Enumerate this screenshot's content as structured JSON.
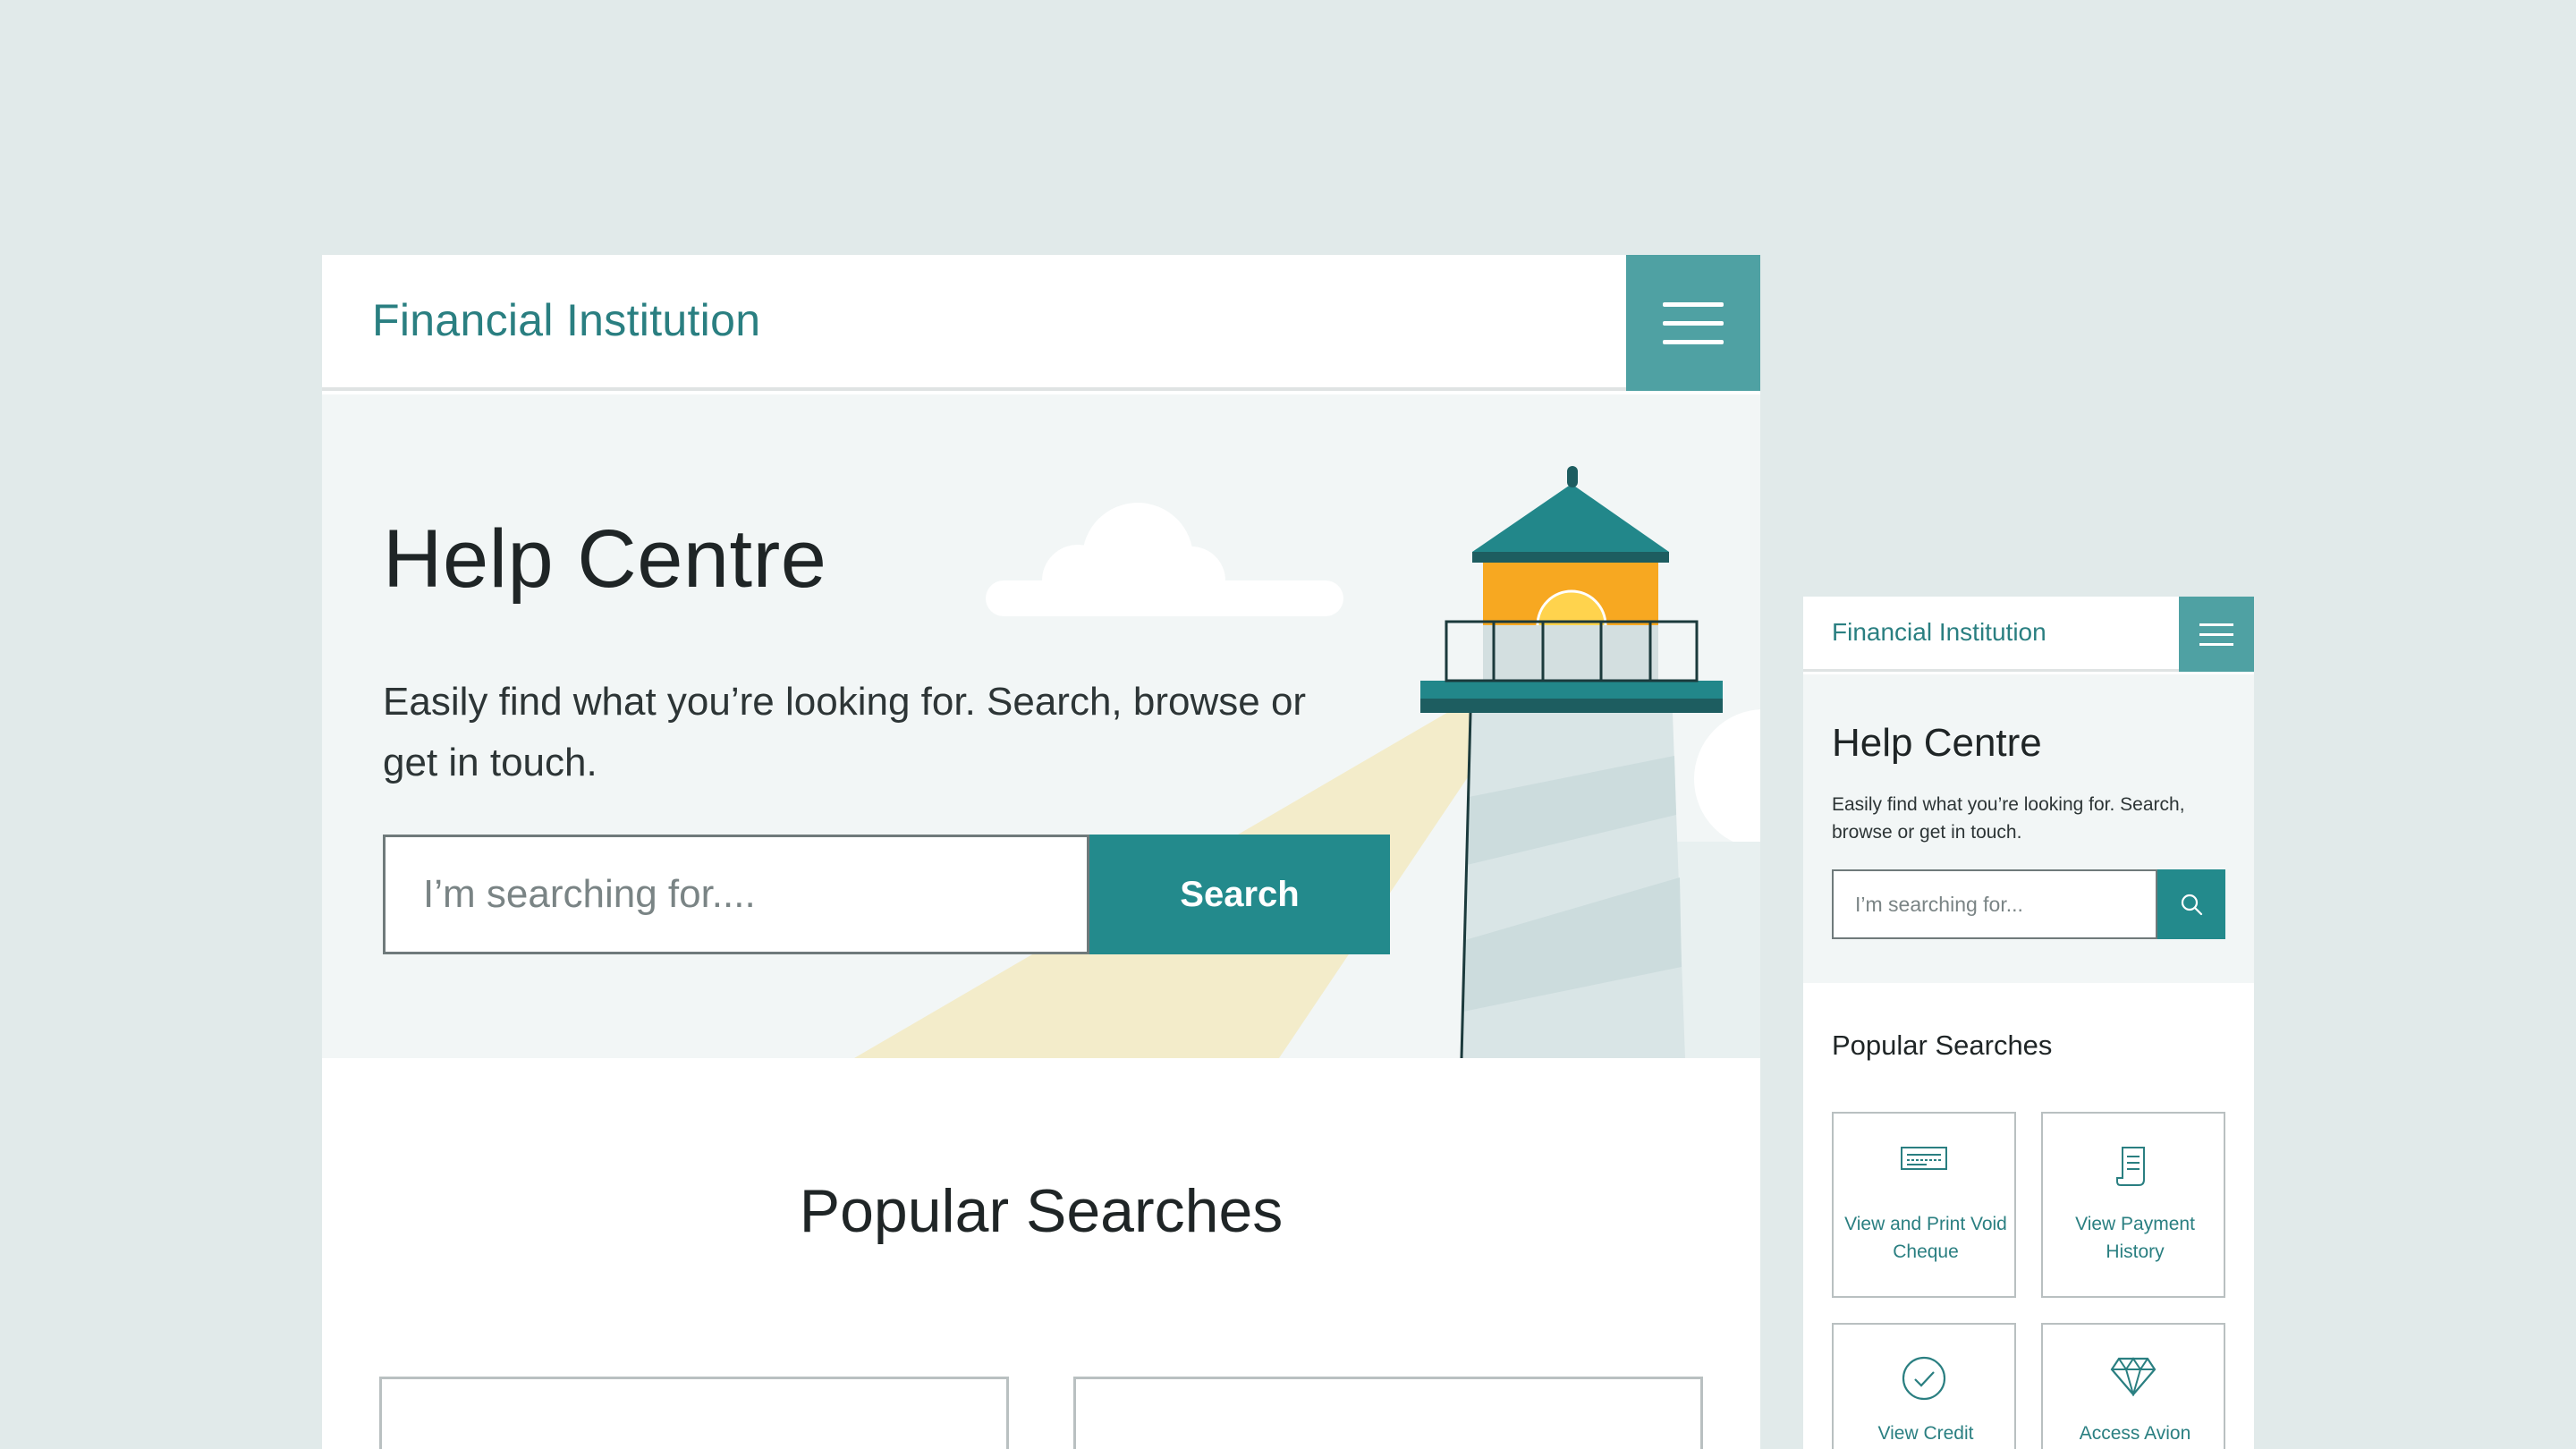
{
  "colors": {
    "background": "#e1eaea",
    "brand": "#2a7f81",
    "accent": "#238a8c",
    "menu": "#4fa1a3",
    "hero": "#f2f6f6",
    "lighthouse_roof": "#22878a",
    "lighthouse_light": "#f7a821",
    "beam": "#f3ecca"
  },
  "desktop": {
    "header": {
      "brand": "Financial Institution"
    },
    "hero": {
      "title": "Help Centre",
      "subtitle": "Easily find what you’re looking for. Search, browse or get in touch.",
      "search_placeholder": "I’m searching for....",
      "search_button": "Search"
    },
    "popular": {
      "title": "Popular Searches"
    }
  },
  "mobile": {
    "header": {
      "brand": "Financial Institution"
    },
    "hero": {
      "title": "Help Centre",
      "subtitle": "Easily find what you’re looking for. Search, browse or get in touch.",
      "search_placeholder": "I’m searching for..."
    },
    "popular": {
      "title": "Popular Searches",
      "tiles": [
        {
          "label": "View and Print Void Cheque",
          "icon": "cheque-icon"
        },
        {
          "label": "View Payment History",
          "icon": "receipt-icon"
        },
        {
          "label": "View Credit",
          "icon": "checkmark-circle-icon"
        },
        {
          "label": "Access Avion",
          "icon": "diamond-icon"
        }
      ]
    }
  }
}
